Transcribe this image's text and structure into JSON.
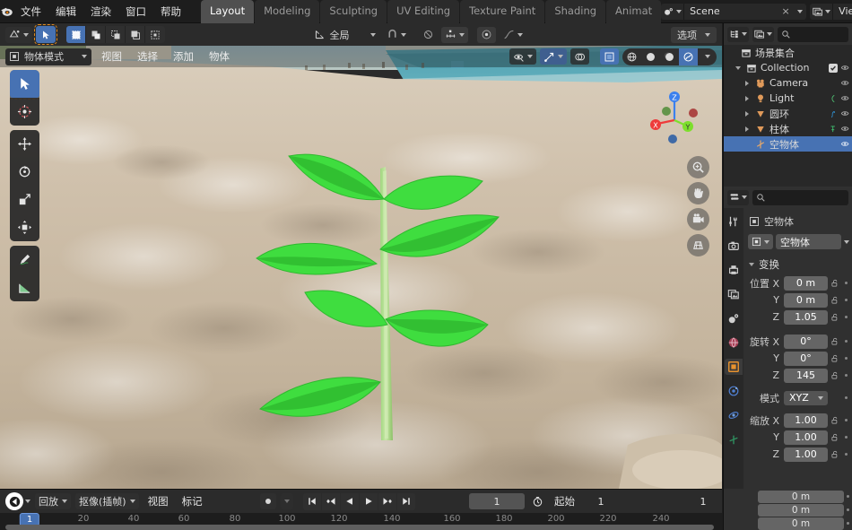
{
  "app": {
    "logo_icon": "blender-logo",
    "menus": [
      "文件",
      "编辑",
      "渲染",
      "窗口",
      "帮助"
    ],
    "workspace_tabs": [
      {
        "label": "Layout",
        "active": true
      },
      {
        "label": "Modeling",
        "active": false
      },
      {
        "label": "Sculpting",
        "active": false
      },
      {
        "label": "UV Editing",
        "active": false
      },
      {
        "label": "Texture Paint",
        "active": false
      },
      {
        "label": "Shading",
        "active": false
      },
      {
        "label": "Animat",
        "active": false
      }
    ],
    "scene": {
      "icon": "scene-icon",
      "value": "Scene",
      "close_label": "×"
    },
    "view_layer": {
      "icon": "view-layer-icon",
      "value": "View Layer",
      "copy_icon": "copy-icon"
    }
  },
  "viewport": {
    "tool_header": {
      "editor_type_icon": "editor-type-icon",
      "active_tool_icon": "tweak-cursor-icon",
      "select_modes": [
        "set-select-icon",
        "extend-select-icon",
        "subtract-select-icon",
        "invert-select-icon",
        "intersect-select-icon"
      ],
      "transform_orientation": {
        "icon": "orientation-icon",
        "label": "全局"
      },
      "snap_icon": "magnet-icon",
      "snap_to_icon": "snap-increment-icon",
      "proportional_icon": "proportional-edit-icon",
      "falloff_icon": "smooth-falloff-icon",
      "options_label": "选项"
    },
    "mode_header": {
      "mode": {
        "icon": "object-mode-icon",
        "label": "物体模式"
      },
      "menus": [
        "视图",
        "选择",
        "添加",
        "物体"
      ],
      "visibility_icon": "show-hide-icon",
      "gizmo_icon": "gizmo-icon",
      "overlays_icon": "overlays-icon",
      "xray_icon": "xray-icon",
      "shading_modes": [
        "wireframe-icon",
        "solid-icon",
        "material-preview-icon",
        "rendered-icon"
      ],
      "shading_active_index": 3
    },
    "toolbar": [
      {
        "name": "tweak-tool",
        "icon": "cursor-arrow-icon",
        "active": true
      },
      {
        "name": "cursor-tool",
        "icon": "3d-cursor-icon",
        "active": false
      },
      {
        "name": "move-tool",
        "icon": "move-arrows-icon",
        "active": false
      },
      {
        "name": "rotate-tool",
        "icon": "rotate-icon",
        "active": false
      },
      {
        "name": "scale-tool",
        "icon": "scale-icon",
        "active": false
      },
      {
        "name": "transform-tool",
        "icon": "transform-icon",
        "active": false
      },
      {
        "name": "annotate-tool",
        "icon": "pencil-icon",
        "active": false
      },
      {
        "name": "measure-tool",
        "icon": "ruler-icon",
        "active": false
      }
    ],
    "nav_gizmo": {
      "axes": [
        "X",
        "Y",
        "Z"
      ],
      "x_color": "#ee3b3b",
      "y_color": "#7ddf2c",
      "z_color": "#3b80ee"
    },
    "nav_buttons": [
      "zoom-icon",
      "pan-hand-icon",
      "camera-view-icon",
      "ortho-persp-icon"
    ]
  },
  "outliner": {
    "display_mode_icon": "outliner-display-icon",
    "filter_icon": "filter-icon",
    "search_placeholder": "",
    "search_icon": "search-icon",
    "rows": [
      {
        "label": "场景集合",
        "icon": "scene-collection-icon",
        "indent": 0,
        "expander": "none",
        "selected": false,
        "checkbox": false
      },
      {
        "label": "Collection",
        "icon": "collection-icon",
        "indent": 1,
        "expander": "down",
        "selected": false,
        "checkbox": true
      },
      {
        "label": "Camera",
        "icon": "camera-data-icon",
        "indent": 2,
        "expander": "right",
        "selected": false,
        "checkbox": false
      },
      {
        "label": "Light",
        "icon": "light-data-icon",
        "indent": 2,
        "expander": "right",
        "selected": false,
        "checkbox": false
      },
      {
        "label": "圆环",
        "icon": "mesh-data-icon",
        "indent": 2,
        "expander": "right",
        "selected": false,
        "checkbox": false
      },
      {
        "label": "柱体",
        "icon": "mesh-data-icon",
        "indent": 2,
        "expander": "right",
        "selected": false,
        "checkbox": false
      },
      {
        "label": "空物体",
        "icon": "empty-axes-icon",
        "indent": 2,
        "expander": "none",
        "selected": true,
        "checkbox": false
      }
    ]
  },
  "properties": {
    "editor_icon": "properties-editor-icon",
    "search_icon": "search-icon",
    "search_placeholder": "",
    "tabs": [
      {
        "name": "tool-tab",
        "icon": "tool-wrench-icon",
        "active": false
      },
      {
        "name": "render-tab",
        "icon": "render-camera-icon",
        "active": false
      },
      {
        "name": "output-tab",
        "icon": "output-printer-icon",
        "active": false
      },
      {
        "name": "view-layer-tab",
        "icon": "view-layer-images-icon",
        "active": false
      },
      {
        "name": "scene-tab",
        "icon": "scene-cone-icon",
        "active": false
      },
      {
        "name": "world-tab",
        "icon": "world-globe-icon",
        "active": false
      },
      {
        "name": "object-tab",
        "icon": "object-square-icon",
        "active": true
      },
      {
        "name": "physics-tab",
        "icon": "physics-orbit-icon",
        "active": false
      },
      {
        "name": "constraints-tab",
        "icon": "constraints-icon",
        "active": false
      },
      {
        "name": "data-tab",
        "icon": "object-data-icon",
        "active": false
      }
    ],
    "breadcrumb": {
      "icon": "object-square-icon",
      "label": "空物体"
    },
    "id_field": {
      "icon": "object-square-icon",
      "value": "空物体"
    },
    "transform_panel": {
      "title": "变换",
      "location": {
        "label": "位置",
        "axes": [
          "X",
          "Y",
          "Z"
        ],
        "values": [
          "0 m",
          "0 m",
          "1.05"
        ]
      },
      "rotation": {
        "label": "旋转",
        "axes": [
          "X",
          "Y",
          "Z"
        ],
        "values": [
          "0°",
          "0°",
          "145"
        ]
      },
      "rotation_mode": {
        "label": "模式",
        "value": "XYZ"
      },
      "scale": {
        "label": "缩放",
        "axes": [
          "X",
          "Y",
          "Z"
        ],
        "values": [
          "1.00",
          "1.00",
          "1.00"
        ]
      },
      "lock_icon": "unlocked-padlock-icon"
    },
    "bottom_fields": {
      "values": [
        "0 m",
        "0 m",
        "0 m"
      ],
      "labels": [
        "",
        "",
        ""
      ]
    }
  },
  "timeline": {
    "editor_icon": "timeline-editor-icon",
    "playback_menu": "回放",
    "keying_menu": "抠像(插帧)",
    "view_menu": "视图",
    "marker_menu": "标记",
    "record_icon": "record-dot-icon",
    "transport": [
      "jump-start-icon",
      "prev-keyframe-icon",
      "play-reverse-icon",
      "play-icon",
      "next-keyframe-icon",
      "jump-end-icon"
    ],
    "current_frame": "1",
    "clock_icon": "clock-icon",
    "start_label": "起始",
    "start_value": "1",
    "end_value": "1",
    "ruler_ticks": [
      "20",
      "40",
      "60",
      "80",
      "100",
      "120",
      "140",
      "160",
      "180",
      "200",
      "220",
      "240"
    ],
    "playhead_label": "1"
  },
  "colors": {
    "accent_blue": "#4772b3",
    "panel_bg": "#303030",
    "editor_bg": "#282828",
    "topbar_bg": "#1d1d1d",
    "orange": "#e08a1e",
    "text": "#e4e4e4"
  }
}
